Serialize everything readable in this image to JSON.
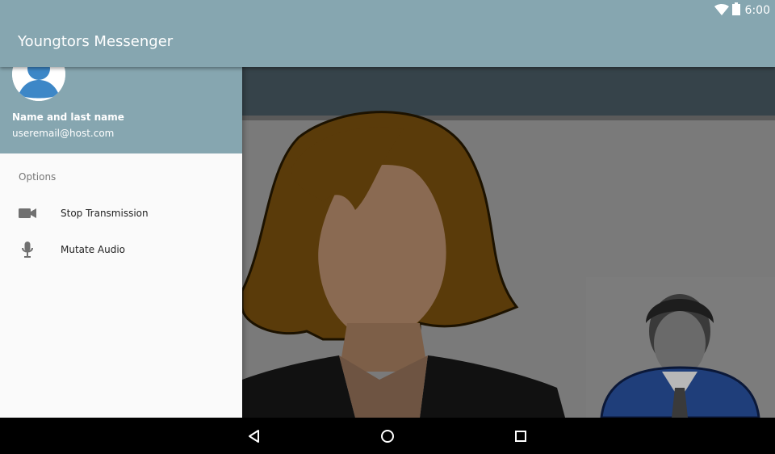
{
  "status_bar": {
    "time": "6:00",
    "icons": [
      "wifi-icon",
      "battery-icon"
    ]
  },
  "appbar": {
    "title": "Youngtors Messenger"
  },
  "drawer": {
    "user": {
      "name": "Name and last name",
      "email": "useremail@host.com"
    },
    "section_header": "Options",
    "items": [
      {
        "label": "Stop Transmission",
        "icon": "videocam-icon"
      },
      {
        "label": "Mutate Audio",
        "icon": "microphone-icon"
      }
    ]
  },
  "navbar": {
    "buttons": [
      "back-icon",
      "home-icon",
      "recents-icon"
    ]
  },
  "colors": {
    "primary": "#86a6b0",
    "drawer_bg": "#fafafa",
    "navbar": "#000000"
  }
}
